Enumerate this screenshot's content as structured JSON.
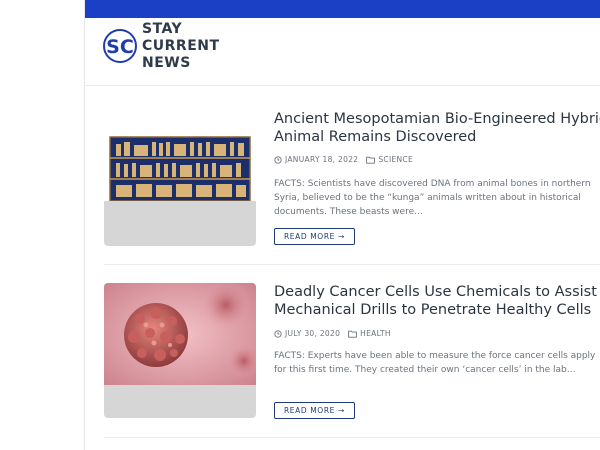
{
  "brand": {
    "initials": "SC",
    "name_lines": [
      "STAY",
      "CURRENT",
      "NEWS"
    ],
    "colors": {
      "topbar": "#1b40c6",
      "logo_blue": "#1e3fa8",
      "link": "#1d3c78"
    }
  },
  "posts": [
    {
      "title_lines": [
        "Ancient Mesopotamian Bio-Engineered Hybrid",
        "Animal Remains Discovered"
      ],
      "date": "JANUARY 18, 2022",
      "category": "SCIENCE",
      "excerpt": "FACTS: Scientists have discovered DNA from animal bones in northern Syria, believed to be the “kunga” animals written about in historical documents. These beasts were…",
      "read_more": "READ MORE →",
      "image_icon": "standard-of-ur-mosaic-image"
    },
    {
      "title_lines": [
        "Deadly Cancer Cells Use Chemicals to Assist",
        "Mechanical Drills to Penetrate Healthy Cells"
      ],
      "date": "JULY 30, 2020",
      "category": "HEALTH",
      "excerpt": "FACTS: Experts have been able to measure the force cancer cells apply for this first time. They created their own ‘cancer cells’ in the lab…",
      "read_more": "READ MORE →",
      "image_icon": "cancer-cell-image"
    }
  ]
}
